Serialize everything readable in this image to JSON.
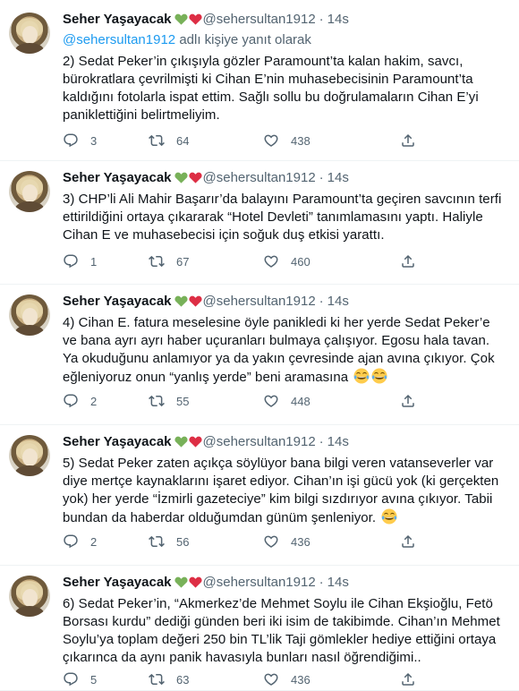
{
  "tweets": [
    {
      "name": "Seher Yaşayacak",
      "handle": "@sehersultan1912",
      "separator": "·",
      "time": "14s",
      "reply_to": {
        "handle": "@sehersultan1912",
        "text": "adlı kişiye yanıt olarak"
      },
      "text": "2) Sedat Peker’in çıkışıyla gözler Paramount’ta kalan hakim, savcı, bürokratlara çevrilmişti ki Cihan E’nin muhasebecisinin Paramount’ta kaldığını fotolarla ispat ettim. Sağlı sollu bu doğrulamaların Cihan E’yi paniklettiğini belirtmeliyim.",
      "replies": "3",
      "retweets": "64",
      "likes": "438"
    },
    {
      "name": "Seher Yaşayacak",
      "handle": "@sehersultan1912",
      "separator": "·",
      "time": "14s",
      "text": "3) CHP’li Ali Mahir Başarır’da balayını Paramount’ta geçiren savcının terfi ettirildiğini ortaya çıkararak “Hotel Devleti” tanımlamasını yaptı. Haliyle Cihan E ve muhasebecisi için soğuk duş etkisi yarattı.",
      "replies": "1",
      "retweets": "67",
      "likes": "460"
    },
    {
      "name": "Seher Yaşayacak",
      "handle": "@sehersultan1912",
      "separator": "·",
      "time": "14s",
      "text": "4) Cihan E. fatura meselesine öyle panikledi ki her yerde Sedat Peker’e ve bana ayrı ayrı haber uçuranları bulmaya çalışıyor. Egosu hala tavan. Ya okuduğunu anlamıyor ya da yakın çevresinde ajan avına çıkıyor. Çok eğleniyoruz onun “yanlış yerde” beni aramasına",
      "emoji_count": 2,
      "replies": "2",
      "retweets": "55",
      "likes": "448"
    },
    {
      "name": "Seher Yaşayacak",
      "handle": "@sehersultan1912",
      "separator": "·",
      "time": "14s",
      "text": "5) Sedat Peker zaten açıkça söylüyor bana bilgi veren vatanseverler var diye mertçe kaynaklarını işaret ediyor. Cihan’ın işi gücü yok (ki gerçekten yok) her yerde “İzmirli gazeteciye” kim bilgi sızdırıyor avına çıkıyor. Tabii bundan da haberdar olduğumdan günüm şenleniyor.",
      "emoji_count": 1,
      "replies": "2",
      "retweets": "56",
      "likes": "436"
    },
    {
      "name": "Seher Yaşayacak",
      "handle": "@sehersultan1912",
      "separator": "·",
      "time": "14s",
      "text": "6) Sedat Peker’in, “Akmerkez’de Mehmet Soylu ile Cihan Ekşioğlu, Fetö Borsası kurdu” dediği günden beri iki isim de takibimde. Cihan’ın Mehmet Soylu’ya toplam değeri 250 bin TL’lik Taji gömlekler hediye ettiğini ortaya çıkarınca da aynı panik havasıyla bunları nasıl öğrendiğimi..",
      "replies": "5",
      "retweets": "63",
      "likes": "436"
    }
  ],
  "colors": {
    "text": "#0f1419",
    "muted": "#536471",
    "link": "#1d9bf0",
    "green_heart": "#78b159",
    "red_heart": "#dd2e44",
    "divider": "#eff3f4"
  },
  "icons": {
    "reply": "reply-icon",
    "retweet": "retweet-icon",
    "like": "like-icon",
    "share": "share-icon",
    "green_heart": "green-heart-icon",
    "red_heart": "red-heart-icon",
    "joy": "face-with-tears-of-joy-icon"
  }
}
